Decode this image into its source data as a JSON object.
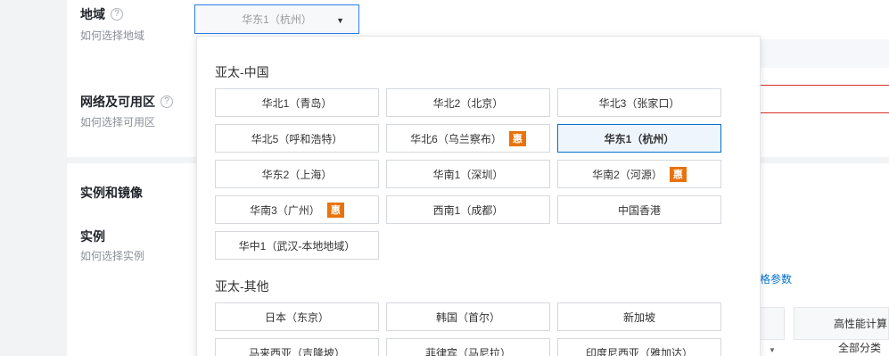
{
  "region_field": {
    "label": "地域",
    "hint": "如何选择地域",
    "help": "?",
    "selected": "华东1（杭州）",
    "caret": "▼"
  },
  "zone_field": {
    "label": "网络及可用区",
    "hint": "如何选择可用区",
    "help": "?"
  },
  "section_title": "实例和镜像",
  "instance_field": {
    "label": "实例",
    "hint": "如何选择实例"
  },
  "background": {
    "spec_link": "格参数",
    "table_header": "高性能计算",
    "table_sub": "全部分类"
  },
  "dropdown": {
    "badge": "惠",
    "groups": [
      {
        "title": "亚太-中国",
        "options": [
          {
            "label": "华北1（青岛）",
            "badge": false,
            "selected": false
          },
          {
            "label": "华北2（北京）",
            "badge": false,
            "selected": false
          },
          {
            "label": "华北3（张家口）",
            "badge": false,
            "selected": false
          },
          {
            "label": "华北5（呼和浩特）",
            "badge": false,
            "selected": false
          },
          {
            "label": "华北6（乌兰察布）",
            "badge": true,
            "selected": false
          },
          {
            "label": "华东1（杭州）",
            "badge": false,
            "selected": true
          },
          {
            "label": "华东2（上海）",
            "badge": false,
            "selected": false
          },
          {
            "label": "华南1（深圳）",
            "badge": false,
            "selected": false
          },
          {
            "label": "华南2（河源）",
            "badge": true,
            "selected": false
          },
          {
            "label": "华南3（广州）",
            "badge": true,
            "selected": false
          },
          {
            "label": "西南1（成都）",
            "badge": false,
            "selected": false
          },
          {
            "label": "中国香港",
            "badge": false,
            "selected": false
          },
          {
            "label": "华中1（武汉-本地地域）",
            "badge": false,
            "selected": false
          }
        ]
      },
      {
        "title": "亚太-其他",
        "options": [
          {
            "label": "日本（东京）",
            "badge": false,
            "selected": false
          },
          {
            "label": "韩国（首尔）",
            "badge": false,
            "selected": false
          },
          {
            "label": "新加坡",
            "badge": false,
            "selected": false
          },
          {
            "label": "马来西亚（吉隆坡）",
            "badge": false,
            "selected": false
          },
          {
            "label": "菲律宾（马尼拉）",
            "badge": false,
            "selected": false
          },
          {
            "label": "印度尼西亚（雅加达）",
            "badge": false,
            "selected": false
          }
        ]
      }
    ]
  }
}
